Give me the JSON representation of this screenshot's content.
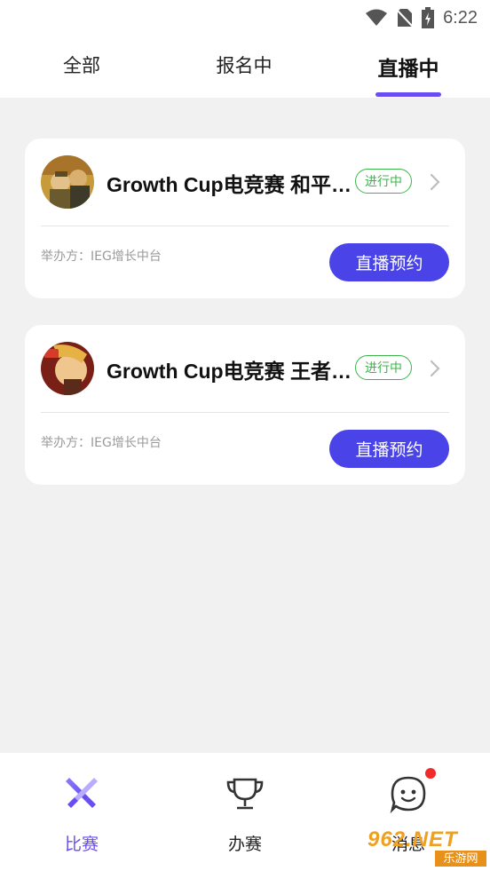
{
  "status_bar": {
    "time": "6:22"
  },
  "tabs": [
    {
      "label": "全部"
    },
    {
      "label": "报名中"
    },
    {
      "label": "直播中"
    }
  ],
  "active_tab": "直播中",
  "events": [
    {
      "title": "Growth Cup电竞赛 和平精英",
      "status": "进行中",
      "organizer": "举办方：IEG增长中台",
      "action": "直播预约"
    },
    {
      "title": "Growth Cup电竞赛 王者荣耀",
      "status": "进行中",
      "organizer": "举办方：IEG增长中台",
      "action": "直播预约"
    }
  ],
  "bottom_nav": [
    {
      "label": "比赛",
      "icon": "swords-icon",
      "active": true
    },
    {
      "label": "办赛",
      "icon": "trophy-icon",
      "active": false
    },
    {
      "label": "消息",
      "icon": "chat-face-icon",
      "active": false,
      "has_notification": true
    }
  ],
  "watermark": {
    "brand": "962.NET",
    "subtitle": "乐游网"
  },
  "colors": {
    "accent": "#6a4cf0",
    "button": "#4a43e8",
    "status_green": "#3bb54a",
    "notification": "#f02b2b"
  }
}
